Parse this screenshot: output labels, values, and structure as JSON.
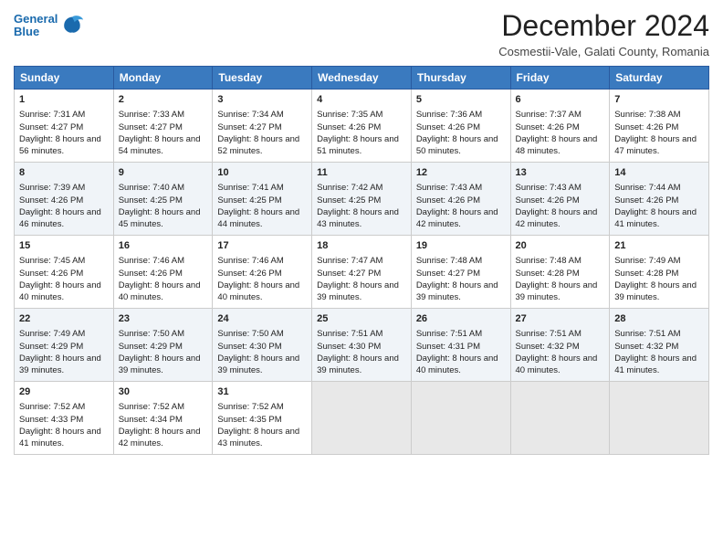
{
  "header": {
    "logo_line1": "General",
    "logo_line2": "Blue",
    "title": "December 2024",
    "subtitle": "Cosmestii-Vale, Galati County, Romania"
  },
  "days_of_week": [
    "Sunday",
    "Monday",
    "Tuesday",
    "Wednesday",
    "Thursday",
    "Friday",
    "Saturday"
  ],
  "weeks": [
    [
      {
        "day": 1,
        "sunrise": "7:31 AM",
        "sunset": "4:27 PM",
        "daylight": "8 hours and 56 minutes."
      },
      {
        "day": 2,
        "sunrise": "7:33 AM",
        "sunset": "4:27 PM",
        "daylight": "8 hours and 54 minutes."
      },
      {
        "day": 3,
        "sunrise": "7:34 AM",
        "sunset": "4:27 PM",
        "daylight": "8 hours and 52 minutes."
      },
      {
        "day": 4,
        "sunrise": "7:35 AM",
        "sunset": "4:26 PM",
        "daylight": "8 hours and 51 minutes."
      },
      {
        "day": 5,
        "sunrise": "7:36 AM",
        "sunset": "4:26 PM",
        "daylight": "8 hours and 50 minutes."
      },
      {
        "day": 6,
        "sunrise": "7:37 AM",
        "sunset": "4:26 PM",
        "daylight": "8 hours and 48 minutes."
      },
      {
        "day": 7,
        "sunrise": "7:38 AM",
        "sunset": "4:26 PM",
        "daylight": "8 hours and 47 minutes."
      }
    ],
    [
      {
        "day": 8,
        "sunrise": "7:39 AM",
        "sunset": "4:26 PM",
        "daylight": "8 hours and 46 minutes."
      },
      {
        "day": 9,
        "sunrise": "7:40 AM",
        "sunset": "4:25 PM",
        "daylight": "8 hours and 45 minutes."
      },
      {
        "day": 10,
        "sunrise": "7:41 AM",
        "sunset": "4:25 PM",
        "daylight": "8 hours and 44 minutes."
      },
      {
        "day": 11,
        "sunrise": "7:42 AM",
        "sunset": "4:25 PM",
        "daylight": "8 hours and 43 minutes."
      },
      {
        "day": 12,
        "sunrise": "7:43 AM",
        "sunset": "4:26 PM",
        "daylight": "8 hours and 42 minutes."
      },
      {
        "day": 13,
        "sunrise": "7:43 AM",
        "sunset": "4:26 PM",
        "daylight": "8 hours and 42 minutes."
      },
      {
        "day": 14,
        "sunrise": "7:44 AM",
        "sunset": "4:26 PM",
        "daylight": "8 hours and 41 minutes."
      }
    ],
    [
      {
        "day": 15,
        "sunrise": "7:45 AM",
        "sunset": "4:26 PM",
        "daylight": "8 hours and 40 minutes."
      },
      {
        "day": 16,
        "sunrise": "7:46 AM",
        "sunset": "4:26 PM",
        "daylight": "8 hours and 40 minutes."
      },
      {
        "day": 17,
        "sunrise": "7:46 AM",
        "sunset": "4:26 PM",
        "daylight": "8 hours and 40 minutes."
      },
      {
        "day": 18,
        "sunrise": "7:47 AM",
        "sunset": "4:27 PM",
        "daylight": "8 hours and 39 minutes."
      },
      {
        "day": 19,
        "sunrise": "7:48 AM",
        "sunset": "4:27 PM",
        "daylight": "8 hours and 39 minutes."
      },
      {
        "day": 20,
        "sunrise": "7:48 AM",
        "sunset": "4:28 PM",
        "daylight": "8 hours and 39 minutes."
      },
      {
        "day": 21,
        "sunrise": "7:49 AM",
        "sunset": "4:28 PM",
        "daylight": "8 hours and 39 minutes."
      }
    ],
    [
      {
        "day": 22,
        "sunrise": "7:49 AM",
        "sunset": "4:29 PM",
        "daylight": "8 hours and 39 minutes."
      },
      {
        "day": 23,
        "sunrise": "7:50 AM",
        "sunset": "4:29 PM",
        "daylight": "8 hours and 39 minutes."
      },
      {
        "day": 24,
        "sunrise": "7:50 AM",
        "sunset": "4:30 PM",
        "daylight": "8 hours and 39 minutes."
      },
      {
        "day": 25,
        "sunrise": "7:51 AM",
        "sunset": "4:30 PM",
        "daylight": "8 hours and 39 minutes."
      },
      {
        "day": 26,
        "sunrise": "7:51 AM",
        "sunset": "4:31 PM",
        "daylight": "8 hours and 40 minutes."
      },
      {
        "day": 27,
        "sunrise": "7:51 AM",
        "sunset": "4:32 PM",
        "daylight": "8 hours and 40 minutes."
      },
      {
        "day": 28,
        "sunrise": "7:51 AM",
        "sunset": "4:32 PM",
        "daylight": "8 hours and 41 minutes."
      }
    ],
    [
      {
        "day": 29,
        "sunrise": "7:52 AM",
        "sunset": "4:33 PM",
        "daylight": "8 hours and 41 minutes."
      },
      {
        "day": 30,
        "sunrise": "7:52 AM",
        "sunset": "4:34 PM",
        "daylight": "8 hours and 42 minutes."
      },
      {
        "day": 31,
        "sunrise": "7:52 AM",
        "sunset": "4:35 PM",
        "daylight": "8 hours and 43 minutes."
      },
      null,
      null,
      null,
      null
    ]
  ]
}
